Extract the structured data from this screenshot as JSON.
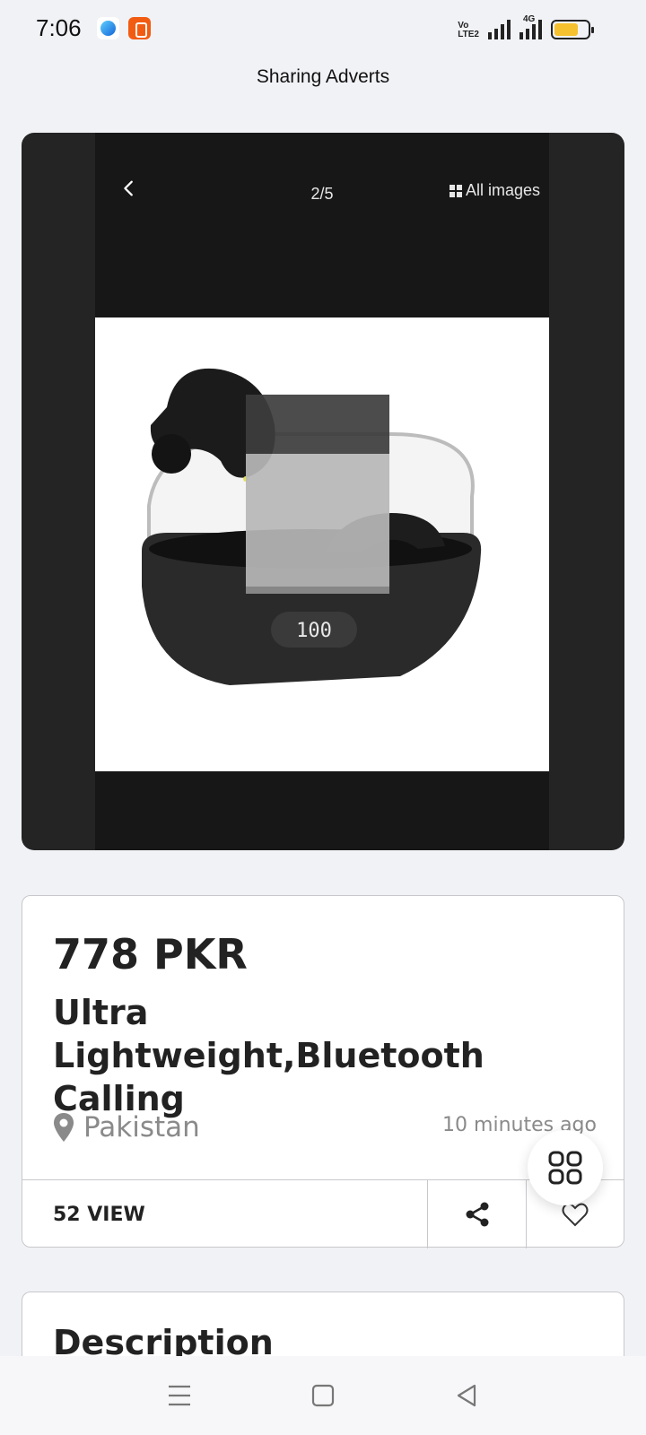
{
  "status_bar": {
    "time": "7:06",
    "network_label": "VoLTE2",
    "network_type": "4G",
    "battery_level": 0.72
  },
  "header": {
    "title": "Sharing Adverts"
  },
  "gallery": {
    "counter": "2/5",
    "all_images_label": "All images",
    "current_index": 2,
    "total_images": 5,
    "image_subject": "open-ear earbuds with charging case and LED display",
    "case_display": "100"
  },
  "product": {
    "price": "778 PKR",
    "title": "Ultra Lightweight,Bluetooth Calling",
    "location": "Pakistan",
    "posted": "10 minutes ago",
    "views": "52 VIEW"
  },
  "description": {
    "heading": "Description"
  },
  "colors": {
    "background": "#f1f2f6",
    "gallery_bg": "#242424",
    "text_dark": "#222222",
    "text_muted": "#8a8a8a",
    "battery": "#f5c12e"
  },
  "icons": {
    "back": "chevron-left-icon",
    "all_images": "grid-icon",
    "location": "map-pin-icon",
    "share": "share-icon",
    "favorite": "heart-icon",
    "fab": "apps-grid-icon",
    "nav_menu": "menu-icon",
    "nav_home": "square-icon",
    "nav_back": "triangle-back-icon"
  }
}
